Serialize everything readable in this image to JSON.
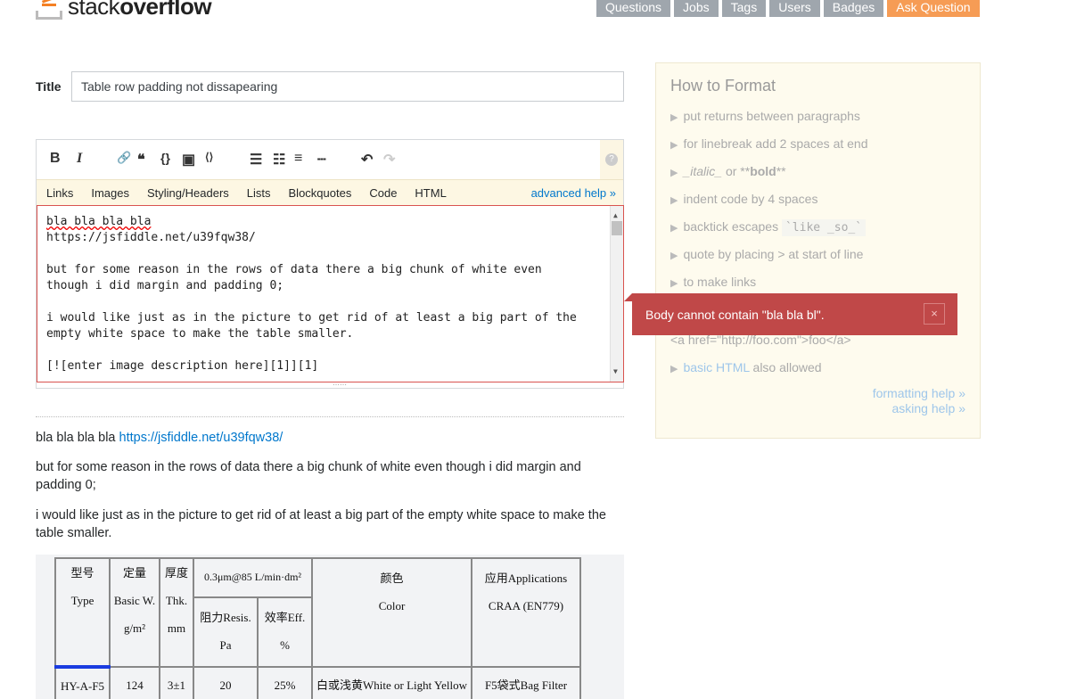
{
  "header": {
    "logo_light": "stack",
    "logo_bold": "overflow",
    "nav": [
      {
        "label": "Questions"
      },
      {
        "label": "Jobs"
      },
      {
        "label": "Tags"
      },
      {
        "label": "Users"
      },
      {
        "label": "Badges"
      },
      {
        "label": "Ask Question"
      }
    ]
  },
  "form": {
    "title_label": "Title",
    "title_value": "Table row padding not dissapearing"
  },
  "editor": {
    "toolbar": {
      "bold": "B",
      "italic": "I",
      "link": "🔗",
      "quote": "❝",
      "code": "{}",
      "image": "▣",
      "snippet": "⟨⟩",
      "ol": "☰",
      "ul": "☷",
      "heading": "≡",
      "hr": "┄",
      "undo": "↶",
      "redo": "↷",
      "help": "?"
    },
    "help_tabs": [
      "Links",
      "Images",
      "Styling/Headers",
      "Lists",
      "Blockquotes",
      "Code",
      "HTML"
    ],
    "advanced_help": "advanced help »",
    "lines": {
      "l1": "bla bla bla bla",
      "l2": "https://jsfiddle.net/u39fqw38/",
      "l3": "but for some reason in the rows of data there a big chunk of white even",
      "l4": "though i did margin and padding 0;",
      "l5": "i would like just as in the picture to get rid of at least a big part of the",
      "l6": "empty white space to make the table smaller.",
      "l7": "[![enter image description here][1]][1]"
    }
  },
  "preview": {
    "p1_text": "bla bla bla bla ",
    "p1_link": "https://jsfiddle.net/u39fqw38/",
    "p2": "but for some reason in the rows of data there a big chunk of white even though i did margin and padding 0;",
    "p3": "i would like just as in the picture to get rid of at least a big part of the empty white space to make the table smaller.",
    "table": {
      "h_type_cn": "型号",
      "h_type": "Type",
      "h_bw_cn": "定量",
      "h_bw": "Basic W.",
      "h_bw_unit": "g/m²",
      "h_thk_cn": "厚度",
      "h_thk": "Thk.",
      "h_thk_unit": "mm",
      "h_test": "0.3μm@85 L/min·dm²",
      "h_res": "阻力Resis.",
      "h_res_unit": "Pa",
      "h_eff": "效率Eff.",
      "h_eff_unit": "%",
      "h_color_cn": "颜色",
      "h_color": "Color",
      "h_app": "应用Applications",
      "h_app2": "CRAA (EN779)",
      "row": [
        "HY-A-F5",
        "124",
        "3±1",
        "20",
        "25%",
        "白或浅黄White or Light Yellow",
        "F5袋式Bag Filter"
      ]
    }
  },
  "sidebar": {
    "title": "How to Format",
    "tips": {
      "t1": "put returns between paragraphs",
      "t2": "for linebreak add 2 spaces at end",
      "t3a": "_italic_",
      "t3b": " or **",
      "t3c": "bold",
      "t3d": "**",
      "t4": "indent code by 4 spaces",
      "t5": "backtick escapes ",
      "t5code": "`like _so_`",
      "t6": "quote by placing > at start of line",
      "t7": "to make links",
      "t8": "<a href=\"http://foo.com\">foo</a>",
      "t9link": "basic HTML",
      "t9": " also allowed"
    },
    "formatting_help": "formatting help »",
    "asking_help": "asking help »"
  },
  "error": {
    "message": "Body cannot contain \"bla bla bl\".",
    "close": "×"
  },
  "colors": {
    "accent": "#f48024",
    "link": "#0077cc",
    "error": "#c04848",
    "nav": "#9fa6ad",
    "ask": "#f69c55"
  }
}
